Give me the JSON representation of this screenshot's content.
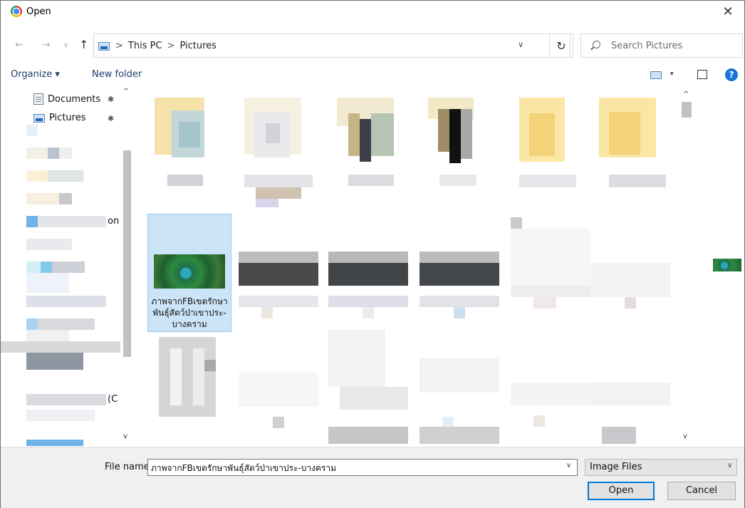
{
  "window": {
    "title": "Open",
    "close_glyph": "✕",
    "icon": "chrome-icon"
  },
  "nav": {
    "back_glyph": "←",
    "forward_glyph": "→",
    "recent_glyph": "∨",
    "up_glyph": "↑",
    "refresh_glyph": "↻"
  },
  "address": {
    "crumbs": [
      "This PC",
      "Pictures"
    ],
    "sep": ">",
    "dropdown_glyph": "∨"
  },
  "search": {
    "placeholder": "Search Pictures"
  },
  "toolbar": {
    "organize_label": "Organize ▾",
    "new_folder_label": "New folder",
    "view_dropdown_glyph": "▾",
    "help_glyph": "?"
  },
  "navpane": {
    "items": [
      {
        "label": "Documents",
        "icon": "document-icon",
        "pinned": true
      },
      {
        "label": "Pictures",
        "icon": "pictures-icon",
        "pinned": true
      }
    ],
    "pin_glyph": "📌",
    "partial_label_1": "on",
    "partial_label_2": "(C",
    "scroll_up_glyph": "^",
    "scroll_down_glyph": "v"
  },
  "content": {
    "selected_file_label": "ภาพจากFBเขตรักษาพันธุ์สัตว์ป่าเขาประ-บางคราม",
    "scroll_up_glyph": "^",
    "scroll_down_glyph": "v"
  },
  "footer": {
    "file_name_label": "File name:",
    "file_name_value": "ภาพจากFBเขตรักษาพันธุ์สัตว์ป่าเขาประ-บางคราม",
    "file_name_dropdown_glyph": "∨",
    "filter_value": "Image Files",
    "filter_dropdown_glyph": "∨",
    "open_label": "Open",
    "cancel_label": "Cancel"
  },
  "colors": {
    "selection_bg": "#cce4f7",
    "selection_border": "#99c9ef",
    "primary_button_border": "#0078d7",
    "help_icon": "#1a73d9",
    "link_text": "#1a3f6f"
  }
}
